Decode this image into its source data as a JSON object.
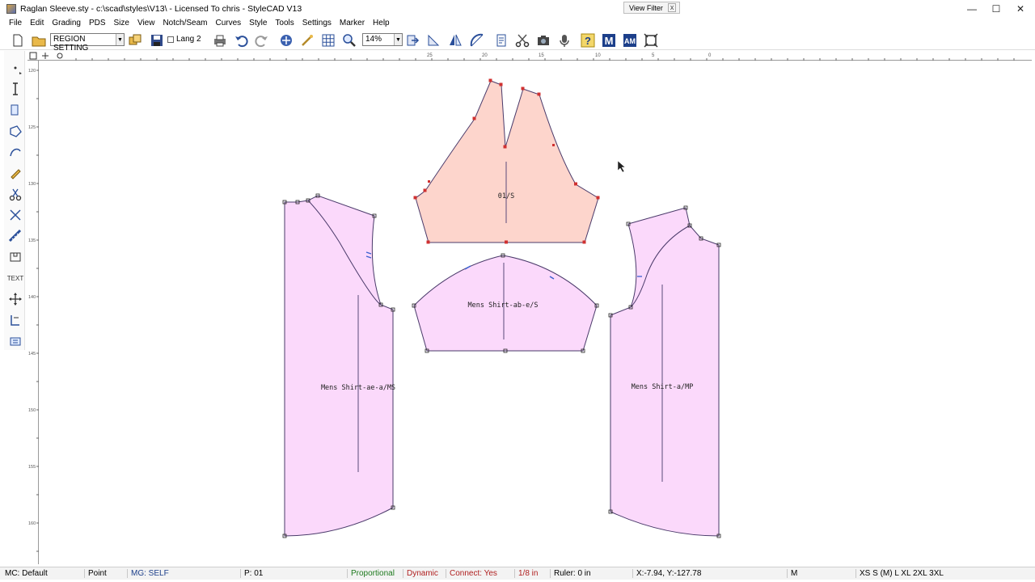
{
  "window": {
    "title": "Raglan Sleeve.sty - c:\\scad\\styles\\V13\\ - Licensed To chris - StyleCAD V13",
    "view_filter": "View Filter",
    "view_filter_close": "x",
    "minimize": "—",
    "maximize": "☐",
    "close": "✕"
  },
  "menu": [
    "File",
    "Edit",
    "Grading",
    "PDS",
    "Size",
    "View",
    "Notch/Seam",
    "Curves",
    "Style",
    "Tools",
    "Settings",
    "Marker",
    "Help"
  ],
  "toolbar": {
    "region_select": "REGION SETTING",
    "lang_label": "Lang 2",
    "zoom_value": "14%"
  },
  "left_tools": {
    "text_tool": "TEXT"
  },
  "rulers": {
    "h_ticks": [
      "25",
      "20",
      "15",
      "10",
      "5",
      "0"
    ],
    "v_ticks": [
      "120",
      "125",
      "130",
      "135",
      "140",
      "145",
      "150",
      "155",
      "160"
    ]
  },
  "pieces": {
    "top_piece_label": "01/S",
    "sleeve_label": "Mens Shirt-ab-e/S",
    "left_label": "Mens Shirt-ae-a/MS",
    "right_label": "Mens Shirt-a/MP"
  },
  "colors": {
    "selected_fill": "#fdd5cc",
    "piece_fill": "#fbd9fb",
    "outline": "#4a3a6a",
    "selected_point": "#d03030",
    "accent_blue": "#1c3f8a"
  },
  "status": {
    "mc": "MC: Default",
    "tool": "Point",
    "mg": "MG: SELF",
    "piece_no": "P: 01",
    "mode": "Proportional",
    "dynamic": "Dynamic",
    "connect": "Connect: Yes",
    "step": "1/8 in",
    "ruler": "Ruler: 0 in",
    "coords": "X:-7.94, Y:-127.78",
    "size_current": "M",
    "sizes": "XS S (M) L XL 2XL 3XL"
  }
}
